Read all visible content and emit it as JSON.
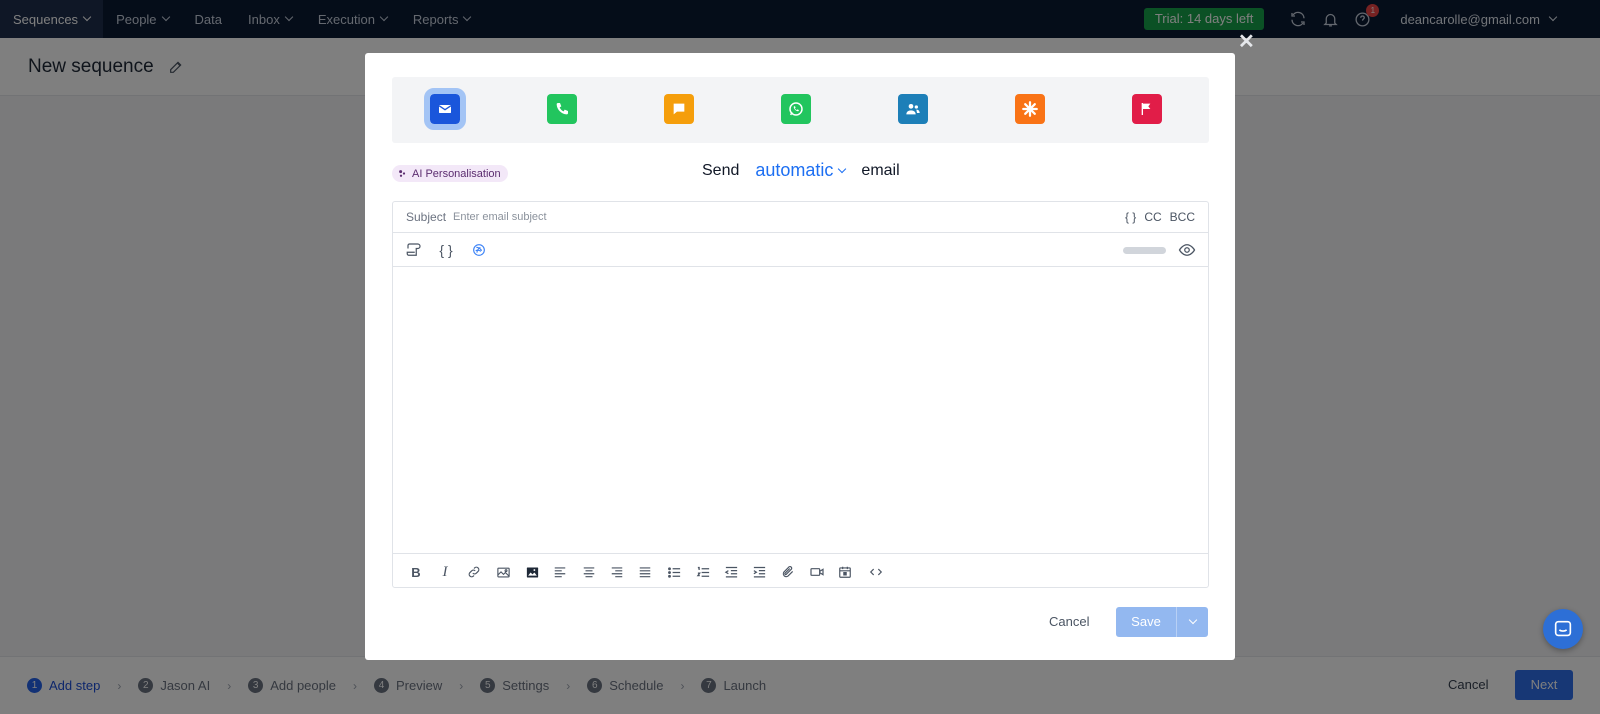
{
  "nav": {
    "items": [
      {
        "label": "Sequences",
        "chevron": true,
        "active": true
      },
      {
        "label": "People",
        "chevron": true,
        "active": false
      },
      {
        "label": "Data",
        "chevron": false,
        "active": false
      },
      {
        "label": "Inbox",
        "chevron": true,
        "active": false
      },
      {
        "label": "Execution",
        "chevron": true,
        "active": false
      },
      {
        "label": "Reports",
        "chevron": true,
        "active": false
      }
    ],
    "trial_label": "Trial: 14 days left",
    "notification_count": "1",
    "user_email": "deancarolle@gmail.com",
    "icons": [
      "refresh-icon",
      "bell-icon",
      "help-icon",
      "chevron-down-icon"
    ]
  },
  "page": {
    "title": "New sequence"
  },
  "stepper": {
    "steps": [
      {
        "num": "1",
        "label": "Add step",
        "active": true
      },
      {
        "num": "2",
        "label": "Jason AI",
        "active": false
      },
      {
        "num": "3",
        "label": "Add people",
        "active": false
      },
      {
        "num": "4",
        "label": "Preview",
        "active": false
      },
      {
        "num": "5",
        "label": "Settings",
        "active": false
      },
      {
        "num": "6",
        "label": "Schedule",
        "active": false
      },
      {
        "num": "7",
        "label": "Launch",
        "active": false
      }
    ],
    "cancel_label": "Cancel",
    "next_label": "Next"
  },
  "modal": {
    "channels": [
      {
        "name": "email",
        "icon": "envelope-icon",
        "color": "#1a56db",
        "selected": true
      },
      {
        "name": "call",
        "icon": "phone-icon",
        "color": "#22c55e",
        "selected": false
      },
      {
        "name": "sms",
        "icon": "chat-icon",
        "color": "#f59e0b",
        "selected": false
      },
      {
        "name": "whatsapp",
        "icon": "whatsapp-icon",
        "color": "#22c55e",
        "selected": false
      },
      {
        "name": "linkedin",
        "icon": "people-icon",
        "color": "#1d7fb8",
        "selected": false
      },
      {
        "name": "zapier",
        "icon": "asterisk-icon",
        "color": "#f97316",
        "selected": false
      },
      {
        "name": "task",
        "icon": "flag-icon",
        "color": "#e11d48",
        "selected": false
      }
    ],
    "ai_badge": "AI Personalisation",
    "send": {
      "prefix": "Send",
      "mode": "automatic",
      "suffix": "email"
    },
    "subject": {
      "label": "Subject",
      "value": "",
      "placeholder": "Enter email subject",
      "cc": "CC",
      "bcc": "BCC",
      "variables": "{ }"
    },
    "toolbar_icons": [
      "template-icon",
      "variables-icon",
      "ai-icon",
      "preview-toggle-icon",
      "eye-icon"
    ],
    "format_icons": [
      "bold-icon",
      "italic-icon",
      "link-icon",
      "image-icon",
      "image-gallery-icon",
      "align-left-icon",
      "align-center-icon",
      "align-right-icon",
      "align-justify-icon",
      "bullet-list-icon",
      "numbered-list-icon",
      "outdent-icon",
      "indent-icon",
      "attachment-icon",
      "video-icon",
      "calendar-icon",
      "code-icon"
    ],
    "body_text": "",
    "cancel_label": "Cancel",
    "save_label": "Save"
  }
}
